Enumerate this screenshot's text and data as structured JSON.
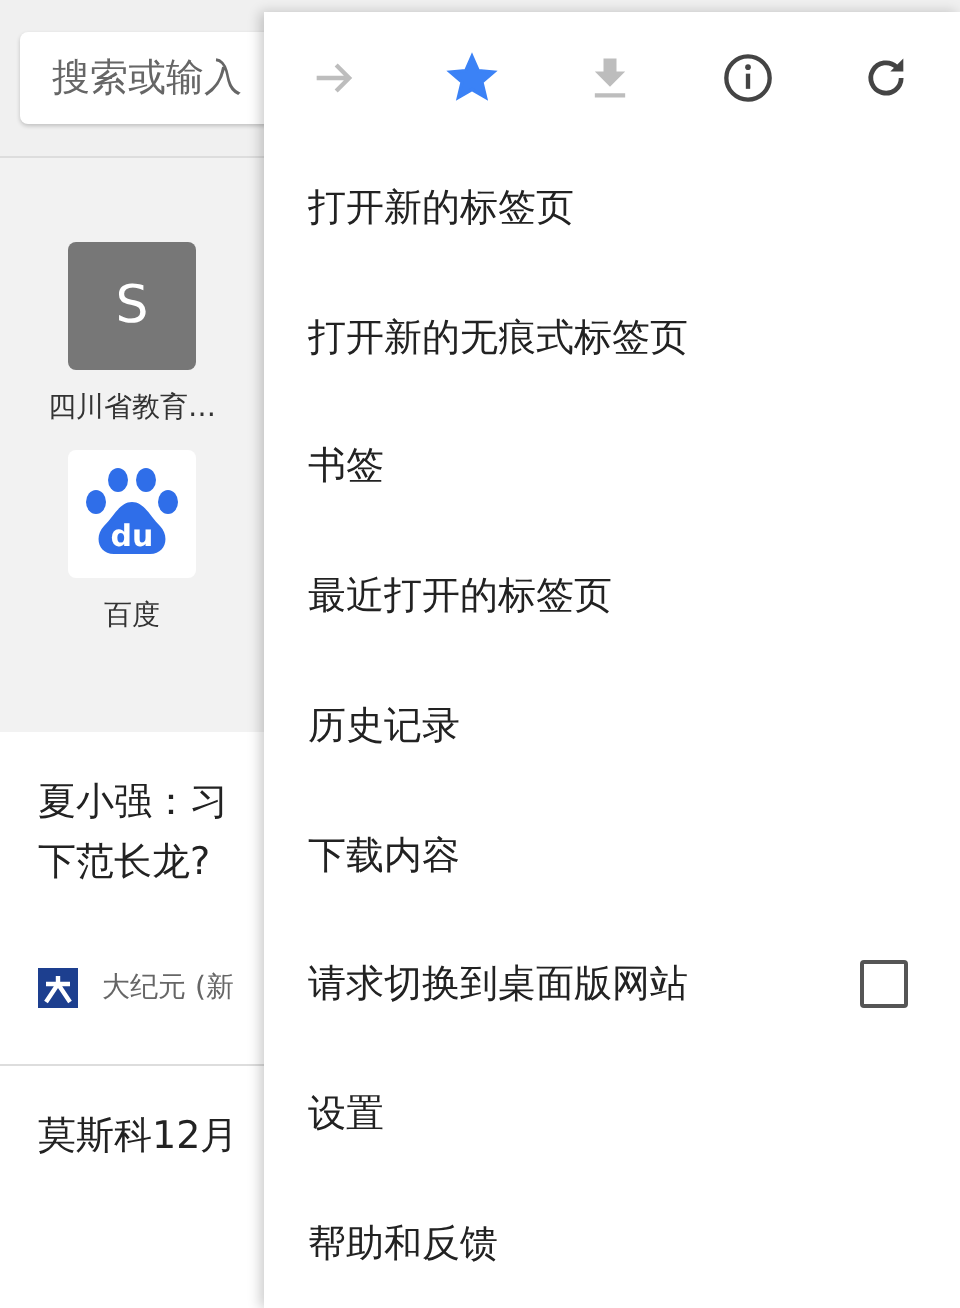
{
  "search": {
    "placeholder": "搜索或输入"
  },
  "tiles": [
    {
      "kind": "letter",
      "letter": "S",
      "label": "四川省教育…"
    },
    {
      "kind": "paw",
      "logo_text": "du",
      "label": "百度"
    }
  ],
  "news": [
    {
      "title_lines": [
        "夏小强：习",
        "下范长龙?"
      ],
      "source": "大纪元 (新"
    },
    {
      "title_lines": [
        "莫斯科12月"
      ]
    }
  ],
  "menu": {
    "toolbar": [
      {
        "kind": "forward",
        "disabled": true
      },
      {
        "kind": "bookmark",
        "selected": true
      },
      {
        "kind": "download",
        "disabled": true
      },
      {
        "kind": "info",
        "disabled": false
      },
      {
        "kind": "reload",
        "disabled": false
      }
    ],
    "items": [
      {
        "kind": "plain",
        "label": "打开新的标签页"
      },
      {
        "kind": "plain",
        "label": "打开新的无痕式标签页"
      },
      {
        "kind": "plain",
        "label": "书签"
      },
      {
        "kind": "plain",
        "label": "最近打开的标签页"
      },
      {
        "kind": "plain",
        "label": "历史记录"
      },
      {
        "kind": "plain",
        "label": "下载内容"
      },
      {
        "kind": "checkbox",
        "label": "请求切换到桌面版网站",
        "checked": false
      },
      {
        "kind": "plain",
        "label": "设置"
      },
      {
        "kind": "plain",
        "label": "帮助和反馈"
      }
    ]
  }
}
